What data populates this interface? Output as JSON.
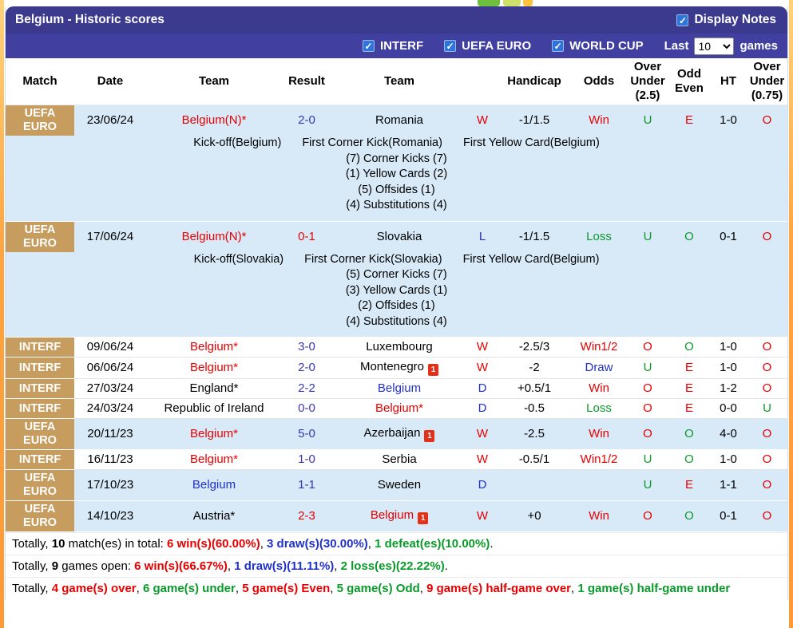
{
  "page": {
    "title": "Belgium - Historic scores",
    "display_notes_label": "Display Notes"
  },
  "filter_bar": {
    "competitions": [
      "INTERF",
      "UEFA EURO",
      "WORLD CUP"
    ],
    "last_label": "Last",
    "count": "10",
    "games_label": "games"
  },
  "table": {
    "headers": [
      "Match",
      "Date",
      "Team",
      "Result",
      "Team",
      "",
      "Handicap",
      "Odds",
      "Over Under (2.5)",
      "Odd Even",
      "HT",
      "Over Under (0.75)"
    ],
    "rows": [
      {
        "match": "UEFA EURO",
        "date": "23/06/24",
        "home": {
          "text": "Belgium(N)*",
          "color": "red",
          "redcard": false
        },
        "result": {
          "text": "2-0",
          "color": "navy"
        },
        "away": {
          "text": "Romania",
          "color": "black",
          "redcard": false
        },
        "wdl": {
          "text": "W",
          "color": "red"
        },
        "handicap": "-1/1.5",
        "odds": {
          "text": "Win",
          "color": "red"
        },
        "ou25": {
          "text": "U",
          "color": "green"
        },
        "oe": {
          "text": "E",
          "color": "red"
        },
        "ht": "1-0",
        "ou075": {
          "text": "O",
          "color": "red"
        },
        "highlight": true,
        "notes": {
          "line1": [
            "Kick-off(Belgium)",
            "First Corner Kick(Romania)",
            "First Yellow Card(Belgium)"
          ],
          "stats": [
            "(7) Corner Kicks (7)",
            "(1) Yellow Cards (2)",
            "(5) Offsides (1)",
            "(4) Substitutions (4)"
          ]
        }
      },
      {
        "match": "UEFA EURO",
        "date": "17/06/24",
        "home": {
          "text": "Belgium(N)*",
          "color": "red",
          "redcard": false
        },
        "result": {
          "text": "0-1",
          "color": "red"
        },
        "away": {
          "text": "Slovakia",
          "color": "black",
          "redcard": false
        },
        "wdl": {
          "text": "L",
          "color": "blue"
        },
        "handicap": "-1/1.5",
        "odds": {
          "text": "Loss",
          "color": "green"
        },
        "ou25": {
          "text": "U",
          "color": "green"
        },
        "oe": {
          "text": "O",
          "color": "green"
        },
        "ht": "0-1",
        "ou075": {
          "text": "O",
          "color": "red"
        },
        "highlight": true,
        "notes": {
          "line1": [
            "Kick-off(Slovakia)",
            "First Corner Kick(Slovakia)",
            "First Yellow Card(Belgium)"
          ],
          "stats": [
            "(5) Corner Kicks (7)",
            "(3) Yellow Cards (1)",
            "(2) Offsides (1)",
            "(4) Substitutions (4)"
          ]
        }
      },
      {
        "match": "INTERF",
        "date": "09/06/24",
        "home": {
          "text": "Belgium*",
          "color": "red",
          "redcard": false
        },
        "result": {
          "text": "3-0",
          "color": "navy"
        },
        "away": {
          "text": "Luxembourg",
          "color": "black",
          "redcard": false
        },
        "wdl": {
          "text": "W",
          "color": "red"
        },
        "handicap": "-2.5/3",
        "odds": {
          "text": "Win1/2",
          "color": "red"
        },
        "ou25": {
          "text": "O",
          "color": "red"
        },
        "oe": {
          "text": "O",
          "color": "green"
        },
        "ht": "1-0",
        "ou075": {
          "text": "O",
          "color": "red"
        },
        "highlight": false,
        "notes": null
      },
      {
        "match": "INTERF",
        "date": "06/06/24",
        "home": {
          "text": "Belgium*",
          "color": "red",
          "redcard": false
        },
        "result": {
          "text": "2-0",
          "color": "navy"
        },
        "away": {
          "text": "Montenegro",
          "color": "black",
          "redcard": true
        },
        "wdl": {
          "text": "W",
          "color": "red"
        },
        "handicap": "-2",
        "odds": {
          "text": "Draw",
          "color": "blue"
        },
        "ou25": {
          "text": "U",
          "color": "green"
        },
        "oe": {
          "text": "E",
          "color": "red"
        },
        "ht": "1-0",
        "ou075": {
          "text": "O",
          "color": "red"
        },
        "highlight": false,
        "notes": null
      },
      {
        "match": "INTERF",
        "date": "27/03/24",
        "home": {
          "text": "England*",
          "color": "black",
          "redcard": false
        },
        "result": {
          "text": "2-2",
          "color": "navy"
        },
        "away": {
          "text": "Belgium",
          "color": "blue",
          "redcard": false
        },
        "wdl": {
          "text": "D",
          "color": "blue"
        },
        "handicap": "+0.5/1",
        "odds": {
          "text": "Win",
          "color": "red"
        },
        "ou25": {
          "text": "O",
          "color": "red"
        },
        "oe": {
          "text": "E",
          "color": "red"
        },
        "ht": "1-2",
        "ou075": {
          "text": "O",
          "color": "red"
        },
        "highlight": false,
        "notes": null
      },
      {
        "match": "INTERF",
        "date": "24/03/24",
        "home": {
          "text": "Republic of Ireland",
          "color": "black",
          "redcard": false
        },
        "result": {
          "text": "0-0",
          "color": "navy"
        },
        "away": {
          "text": "Belgium*",
          "color": "red",
          "redcard": false
        },
        "wdl": {
          "text": "D",
          "color": "blue"
        },
        "handicap": "-0.5",
        "odds": {
          "text": "Loss",
          "color": "green"
        },
        "ou25": {
          "text": "O",
          "color": "red"
        },
        "oe": {
          "text": "E",
          "color": "red"
        },
        "ht": "0-0",
        "ou075": {
          "text": "U",
          "color": "green"
        },
        "highlight": false,
        "notes": null
      },
      {
        "match": "UEFA EURO",
        "date": "20/11/23",
        "home": {
          "text": "Belgium*",
          "color": "red",
          "redcard": false
        },
        "result": {
          "text": "5-0",
          "color": "navy"
        },
        "away": {
          "text": "Azerbaijan",
          "color": "black",
          "redcard": true
        },
        "wdl": {
          "text": "W",
          "color": "red"
        },
        "handicap": "-2.5",
        "odds": {
          "text": "Win",
          "color": "red"
        },
        "ou25": {
          "text": "O",
          "color": "red"
        },
        "oe": {
          "text": "O",
          "color": "green"
        },
        "ht": "4-0",
        "ou075": {
          "text": "O",
          "color": "red"
        },
        "highlight": true,
        "notes": null
      },
      {
        "match": "INTERF",
        "date": "16/11/23",
        "home": {
          "text": "Belgium*",
          "color": "red",
          "redcard": false
        },
        "result": {
          "text": "1-0",
          "color": "navy"
        },
        "away": {
          "text": "Serbia",
          "color": "black",
          "redcard": false
        },
        "wdl": {
          "text": "W",
          "color": "red"
        },
        "handicap": "-0.5/1",
        "odds": {
          "text": "Win1/2",
          "color": "red"
        },
        "ou25": {
          "text": "U",
          "color": "green"
        },
        "oe": {
          "text": "O",
          "color": "green"
        },
        "ht": "1-0",
        "ou075": {
          "text": "O",
          "color": "red"
        },
        "highlight": false,
        "notes": null
      },
      {
        "match": "UEFA EURO",
        "date": "17/10/23",
        "home": {
          "text": "Belgium",
          "color": "blue",
          "redcard": false
        },
        "result": {
          "text": "1-1",
          "color": "navy"
        },
        "away": {
          "text": "Sweden",
          "color": "black",
          "redcard": false
        },
        "wdl": {
          "text": "D",
          "color": "blue"
        },
        "handicap": "",
        "odds": {
          "text": "",
          "color": "black"
        },
        "ou25": {
          "text": "U",
          "color": "green"
        },
        "oe": {
          "text": "E",
          "color": "red"
        },
        "ht": "1-1",
        "ou075": {
          "text": "O",
          "color": "red"
        },
        "highlight": true,
        "notes": null
      },
      {
        "match": "UEFA EURO",
        "date": "14/10/23",
        "home": {
          "text": "Austria*",
          "color": "black",
          "redcard": false
        },
        "result": {
          "text": "2-3",
          "color": "red"
        },
        "away": {
          "text": "Belgium",
          "color": "red",
          "redcard": true
        },
        "wdl": {
          "text": "W",
          "color": "red"
        },
        "handicap": "+0",
        "odds": {
          "text": "Win",
          "color": "red"
        },
        "ou25": {
          "text": "O",
          "color": "red"
        },
        "oe": {
          "text": "O",
          "color": "green"
        },
        "ht": "0-1",
        "ou075": {
          "text": "O",
          "color": "red"
        },
        "highlight": true,
        "notes": null
      }
    ]
  },
  "footer": {
    "lines": [
      [
        {
          "t": "Totally, ",
          "c": "black",
          "b": false
        },
        {
          "t": "10",
          "c": "black",
          "b": true
        },
        {
          "t": " match(es) in total: ",
          "c": "black",
          "b": false
        },
        {
          "t": "6 win(s)(60.00%)",
          "c": "red",
          "b": true
        },
        {
          "t": ", ",
          "c": "black",
          "b": false
        },
        {
          "t": "3 draw(s)(30.00%)",
          "c": "blue",
          "b": true
        },
        {
          "t": ", ",
          "c": "black",
          "b": false
        },
        {
          "t": "1 defeat(es)(10.00%)",
          "c": "green",
          "b": true
        },
        {
          "t": ".",
          "c": "black",
          "b": false
        }
      ],
      [
        {
          "t": "Totally, ",
          "c": "black",
          "b": false
        },
        {
          "t": "9",
          "c": "black",
          "b": true
        },
        {
          "t": " games open: ",
          "c": "black",
          "b": false
        },
        {
          "t": "6 win(s)(66.67%)",
          "c": "red",
          "b": true
        },
        {
          "t": ", ",
          "c": "black",
          "b": false
        },
        {
          "t": "1 draw(s)(11.11%)",
          "c": "blue",
          "b": true
        },
        {
          "t": ", ",
          "c": "black",
          "b": false
        },
        {
          "t": "2 loss(es)(22.22%)",
          "c": "green",
          "b": true
        },
        {
          "t": ".",
          "c": "black",
          "b": false
        }
      ],
      [
        {
          "t": "Totally, ",
          "c": "black",
          "b": false
        },
        {
          "t": "4 game(s) over",
          "c": "red",
          "b": true
        },
        {
          "t": ", ",
          "c": "black",
          "b": false
        },
        {
          "t": "6 game(s) under",
          "c": "green",
          "b": true
        },
        {
          "t": ", ",
          "c": "black",
          "b": false
        },
        {
          "t": "5 game(s) Even",
          "c": "red",
          "b": true
        },
        {
          "t": ", ",
          "c": "black",
          "b": false
        },
        {
          "t": "5 game(s) Odd",
          "c": "green",
          "b": true
        },
        {
          "t": ", ",
          "c": "black",
          "b": false
        },
        {
          "t": "9 game(s) half-game over",
          "c": "red",
          "b": true
        },
        {
          "t": ", ",
          "c": "black",
          "b": false
        },
        {
          "t": "1 game(s) half-game under",
          "c": "green",
          "b": true
        }
      ]
    ]
  }
}
